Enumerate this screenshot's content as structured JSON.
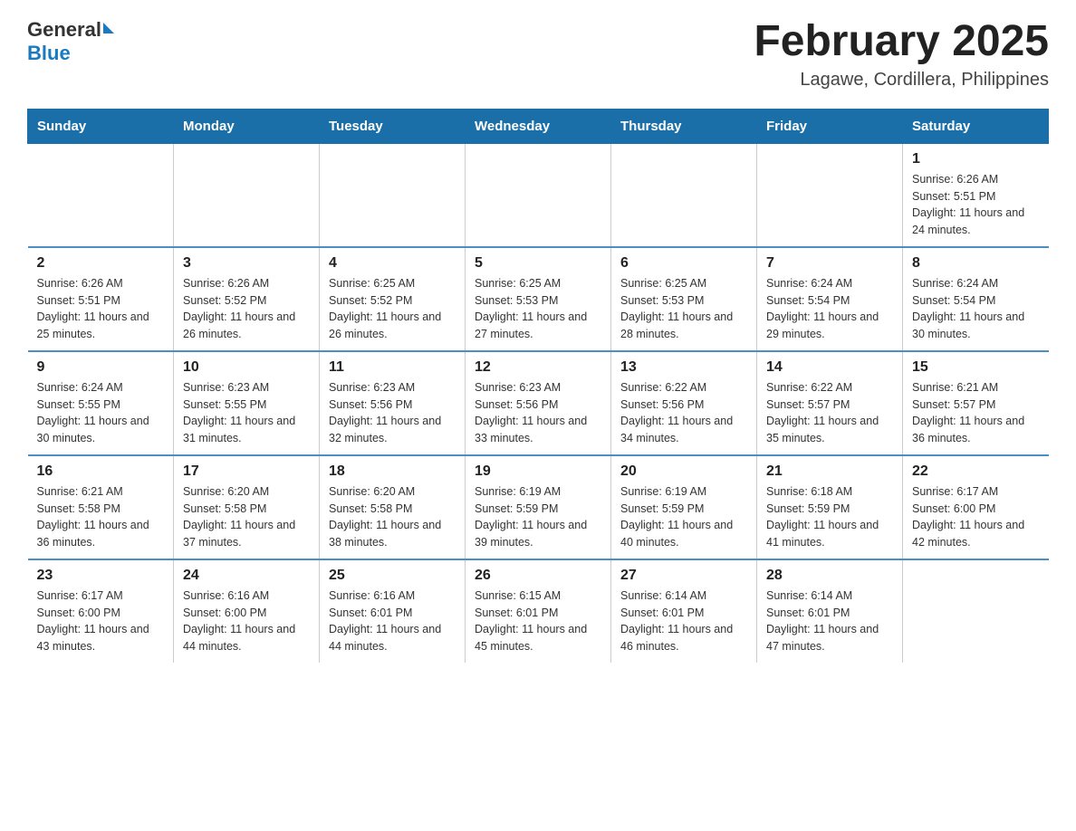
{
  "header": {
    "title": "February 2025",
    "subtitle": "Lagawe, Cordillera, Philippines"
  },
  "logo": {
    "general": "General",
    "blue": "Blue"
  },
  "days": [
    "Sunday",
    "Monday",
    "Tuesday",
    "Wednesday",
    "Thursday",
    "Friday",
    "Saturday"
  ],
  "weeks": [
    [
      {
        "num": "",
        "info": ""
      },
      {
        "num": "",
        "info": ""
      },
      {
        "num": "",
        "info": ""
      },
      {
        "num": "",
        "info": ""
      },
      {
        "num": "",
        "info": ""
      },
      {
        "num": "",
        "info": ""
      },
      {
        "num": "1",
        "info": "Sunrise: 6:26 AM\nSunset: 5:51 PM\nDaylight: 11 hours and 24 minutes."
      }
    ],
    [
      {
        "num": "2",
        "info": "Sunrise: 6:26 AM\nSunset: 5:51 PM\nDaylight: 11 hours and 25 minutes."
      },
      {
        "num": "3",
        "info": "Sunrise: 6:26 AM\nSunset: 5:52 PM\nDaylight: 11 hours and 26 minutes."
      },
      {
        "num": "4",
        "info": "Sunrise: 6:25 AM\nSunset: 5:52 PM\nDaylight: 11 hours and 26 minutes."
      },
      {
        "num": "5",
        "info": "Sunrise: 6:25 AM\nSunset: 5:53 PM\nDaylight: 11 hours and 27 minutes."
      },
      {
        "num": "6",
        "info": "Sunrise: 6:25 AM\nSunset: 5:53 PM\nDaylight: 11 hours and 28 minutes."
      },
      {
        "num": "7",
        "info": "Sunrise: 6:24 AM\nSunset: 5:54 PM\nDaylight: 11 hours and 29 minutes."
      },
      {
        "num": "8",
        "info": "Sunrise: 6:24 AM\nSunset: 5:54 PM\nDaylight: 11 hours and 30 minutes."
      }
    ],
    [
      {
        "num": "9",
        "info": "Sunrise: 6:24 AM\nSunset: 5:55 PM\nDaylight: 11 hours and 30 minutes."
      },
      {
        "num": "10",
        "info": "Sunrise: 6:23 AM\nSunset: 5:55 PM\nDaylight: 11 hours and 31 minutes."
      },
      {
        "num": "11",
        "info": "Sunrise: 6:23 AM\nSunset: 5:56 PM\nDaylight: 11 hours and 32 minutes."
      },
      {
        "num": "12",
        "info": "Sunrise: 6:23 AM\nSunset: 5:56 PM\nDaylight: 11 hours and 33 minutes."
      },
      {
        "num": "13",
        "info": "Sunrise: 6:22 AM\nSunset: 5:56 PM\nDaylight: 11 hours and 34 minutes."
      },
      {
        "num": "14",
        "info": "Sunrise: 6:22 AM\nSunset: 5:57 PM\nDaylight: 11 hours and 35 minutes."
      },
      {
        "num": "15",
        "info": "Sunrise: 6:21 AM\nSunset: 5:57 PM\nDaylight: 11 hours and 36 minutes."
      }
    ],
    [
      {
        "num": "16",
        "info": "Sunrise: 6:21 AM\nSunset: 5:58 PM\nDaylight: 11 hours and 36 minutes."
      },
      {
        "num": "17",
        "info": "Sunrise: 6:20 AM\nSunset: 5:58 PM\nDaylight: 11 hours and 37 minutes."
      },
      {
        "num": "18",
        "info": "Sunrise: 6:20 AM\nSunset: 5:58 PM\nDaylight: 11 hours and 38 minutes."
      },
      {
        "num": "19",
        "info": "Sunrise: 6:19 AM\nSunset: 5:59 PM\nDaylight: 11 hours and 39 minutes."
      },
      {
        "num": "20",
        "info": "Sunrise: 6:19 AM\nSunset: 5:59 PM\nDaylight: 11 hours and 40 minutes."
      },
      {
        "num": "21",
        "info": "Sunrise: 6:18 AM\nSunset: 5:59 PM\nDaylight: 11 hours and 41 minutes."
      },
      {
        "num": "22",
        "info": "Sunrise: 6:17 AM\nSunset: 6:00 PM\nDaylight: 11 hours and 42 minutes."
      }
    ],
    [
      {
        "num": "23",
        "info": "Sunrise: 6:17 AM\nSunset: 6:00 PM\nDaylight: 11 hours and 43 minutes."
      },
      {
        "num": "24",
        "info": "Sunrise: 6:16 AM\nSunset: 6:00 PM\nDaylight: 11 hours and 44 minutes."
      },
      {
        "num": "25",
        "info": "Sunrise: 6:16 AM\nSunset: 6:01 PM\nDaylight: 11 hours and 44 minutes."
      },
      {
        "num": "26",
        "info": "Sunrise: 6:15 AM\nSunset: 6:01 PM\nDaylight: 11 hours and 45 minutes."
      },
      {
        "num": "27",
        "info": "Sunrise: 6:14 AM\nSunset: 6:01 PM\nDaylight: 11 hours and 46 minutes."
      },
      {
        "num": "28",
        "info": "Sunrise: 6:14 AM\nSunset: 6:01 PM\nDaylight: 11 hours and 47 minutes."
      },
      {
        "num": "",
        "info": ""
      }
    ]
  ]
}
